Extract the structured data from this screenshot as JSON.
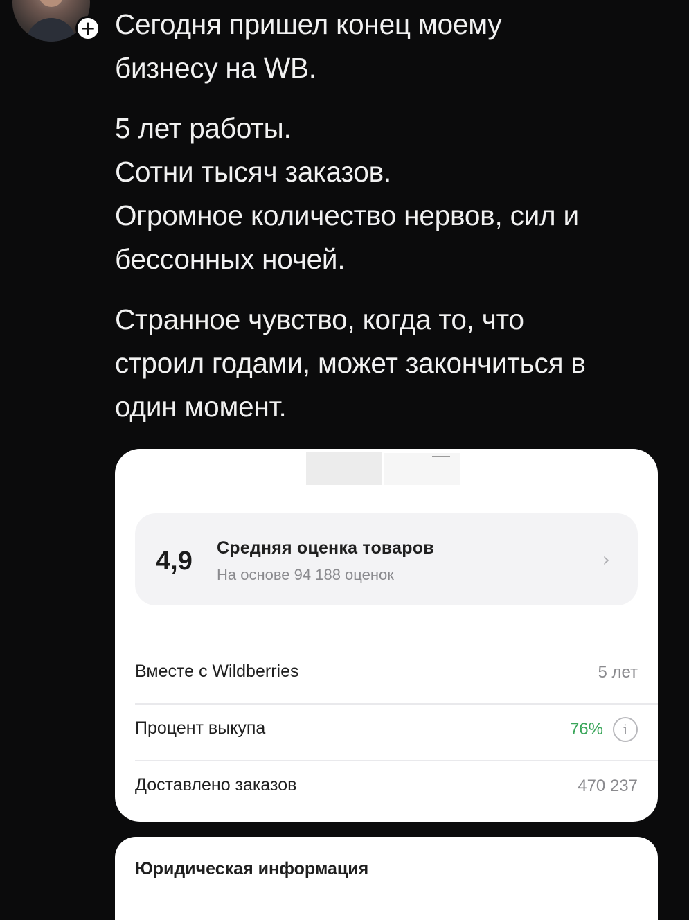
{
  "post": {
    "paragraphs": [
      [
        "Сегодня пришел конец моему",
        "бизнесу на WB."
      ],
      [
        "5 лет работы.",
        "Сотни тысяч заказов.",
        "Огромное количество нервов, сил и",
        "бессонных ночей."
      ],
      [
        "Странное чувство, когда то, что",
        "строил годами, может закончиться в",
        "один момент."
      ]
    ]
  },
  "author": {
    "follow_icon": "+"
  },
  "card": {
    "rating": {
      "value": "4,9",
      "title": "Средняя оценка товаров",
      "subtitle": "На основе 94 188 оценок",
      "chevron": "›"
    },
    "rows": [
      {
        "label": "Вместе с Wildberries",
        "value": "5 лет"
      },
      {
        "label": "Процент выкупа",
        "value": "76%",
        "value_color": "#3aa65a",
        "info_icon": "i"
      },
      {
        "label": "Доставлено заказов",
        "value": "470 237"
      }
    ]
  },
  "legal": {
    "title": "Юридическая информация"
  }
}
